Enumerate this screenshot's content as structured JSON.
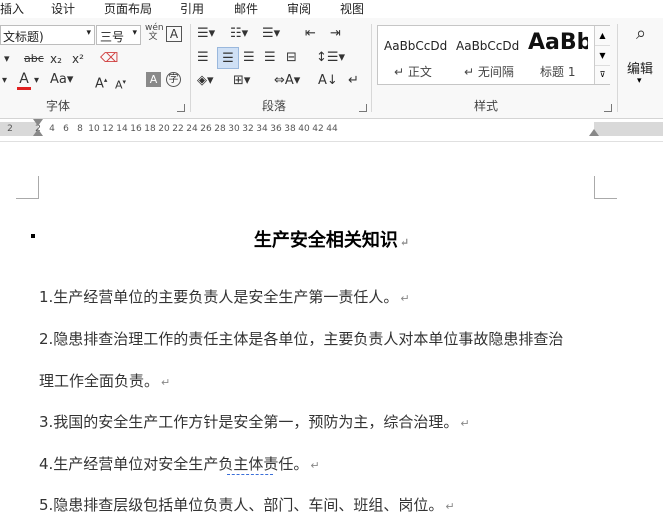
{
  "tabs": [
    "插入",
    "设计",
    "页面布局",
    "引用",
    "邮件",
    "审阅",
    "视图"
  ],
  "font": {
    "name_value": "文标题)",
    "size_value": "三号",
    "group_label": "字体"
  },
  "paragraph": {
    "group_label": "段落"
  },
  "styles": {
    "group_label": "样式",
    "items": [
      {
        "preview": "AaBbCcDd",
        "name": "↵ 正文"
      },
      {
        "preview": "AaBbCcDd",
        "name": "↵ 无间隔"
      },
      {
        "preview": "AaBb",
        "name": "标题 1"
      }
    ]
  },
  "editing": {
    "label": "编辑"
  },
  "ruler": {
    "ticks": [
      "2",
      "2",
      "4",
      "6",
      "8",
      "10",
      "12",
      "14",
      "16",
      "18",
      "20",
      "22",
      "24",
      "26",
      "28",
      "30",
      "32",
      "34",
      "36",
      "38",
      "40",
      "42",
      "44"
    ]
  },
  "document": {
    "title": "生产安全相关知识",
    "paragraphs": [
      "1.生产经营单位的主要负责人是安全生产第一责任人。",
      "2.隐患排查治理工作的责任主体是各单位，主要负责人对本单位事故隐患排查治",
      "理工作全面负责。",
      "3.我国的安全生产工作方针是安全第一，预防为主，综合治理。",
      "4.生产经营单位对安全生产负主体责任。",
      "5.隐患排查层级包括单位负责人、部门、车间、班组、岗位。"
    ],
    "para_mark": "↵",
    "colors": {
      "accent_red": "#e02020",
      "active_blue": "#cfe0f5"
    }
  }
}
